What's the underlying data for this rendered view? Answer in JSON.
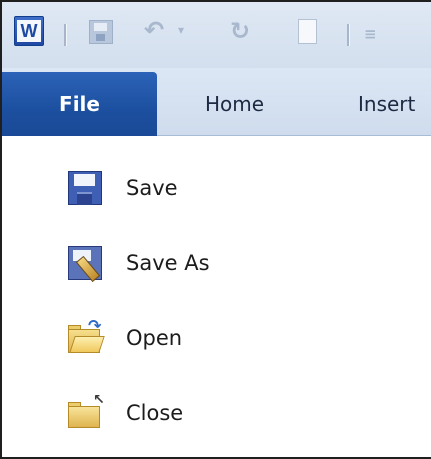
{
  "app": {
    "logo_letter": "W"
  },
  "ribbon": {
    "tabs": [
      {
        "label": "File"
      },
      {
        "label": "Home"
      },
      {
        "label": "Insert"
      }
    ]
  },
  "file_menu": {
    "items": [
      {
        "label": "Save",
        "icon": "save-icon"
      },
      {
        "label": "Save As",
        "icon": "save-as-icon"
      },
      {
        "label": "Open",
        "icon": "open-folder-icon"
      },
      {
        "label": "Close",
        "icon": "close-folder-icon"
      }
    ]
  },
  "colors": {
    "file_tab": "#1c4f9f",
    "ribbon_bg": "#d6e2f1",
    "text": "#1c1c1c"
  }
}
